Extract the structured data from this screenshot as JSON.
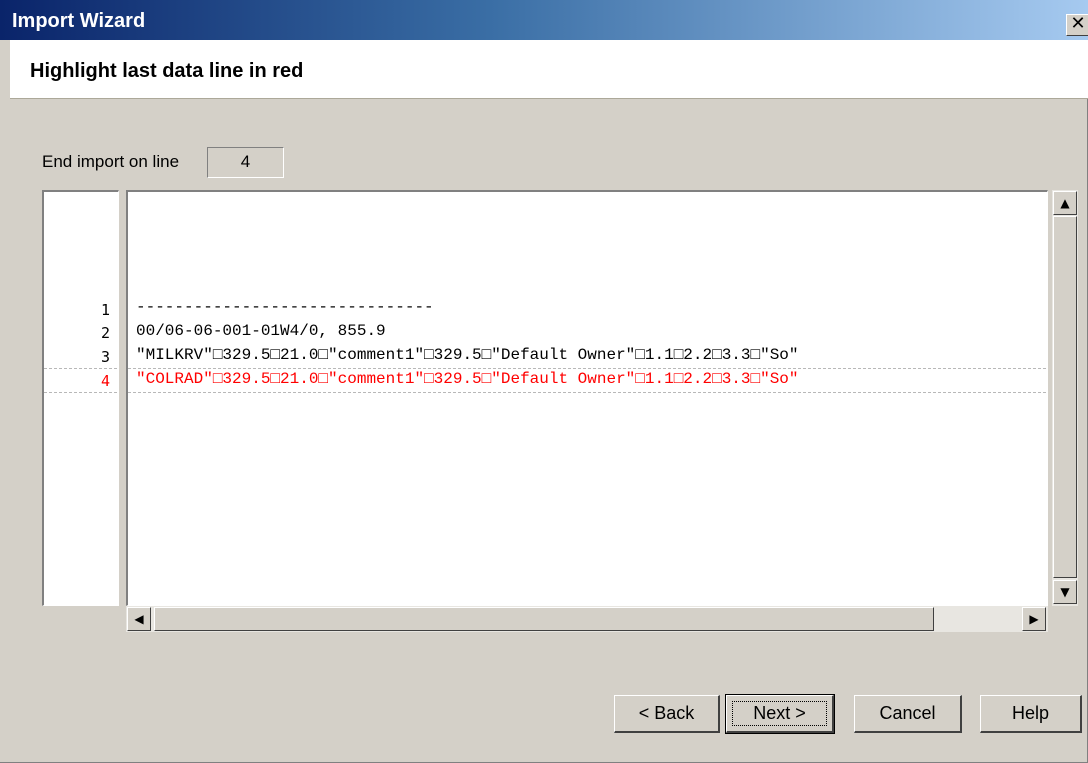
{
  "window": {
    "title": "Import Wizard",
    "close_glyph": "✕"
  },
  "header": {
    "title": "Highlight last data line in red"
  },
  "end_import": {
    "label": "End import on line",
    "value": "4"
  },
  "preview": {
    "lines": [
      {
        "number": "1",
        "text": "-------------------------------",
        "highlight": false
      },
      {
        "number": "2",
        "text": "00/06-06-001-01W4/0, 855.9",
        "highlight": false
      },
      {
        "number": "3",
        "text": "\"MILKRV\"□329.5□21.0□\"comment1\"□329.5□\"Default Owner\"□1.1□2.2□3.3□\"So\"",
        "highlight": false
      },
      {
        "number": "4",
        "text": "\"COLRAD\"□329.5□21.0□\"comment1\"□329.5□\"Default Owner\"□1.1□2.2□3.3□\"So\"",
        "highlight": true
      }
    ],
    "highlight_color": "#ff0000"
  },
  "scrollbars": {
    "up_arrow": "▲",
    "down_arrow": "▼",
    "left_arrow": "◀",
    "right_arrow": "▶"
  },
  "buttons": {
    "back": "< Back",
    "next": "Next >",
    "cancel": "Cancel",
    "help": "Help"
  }
}
